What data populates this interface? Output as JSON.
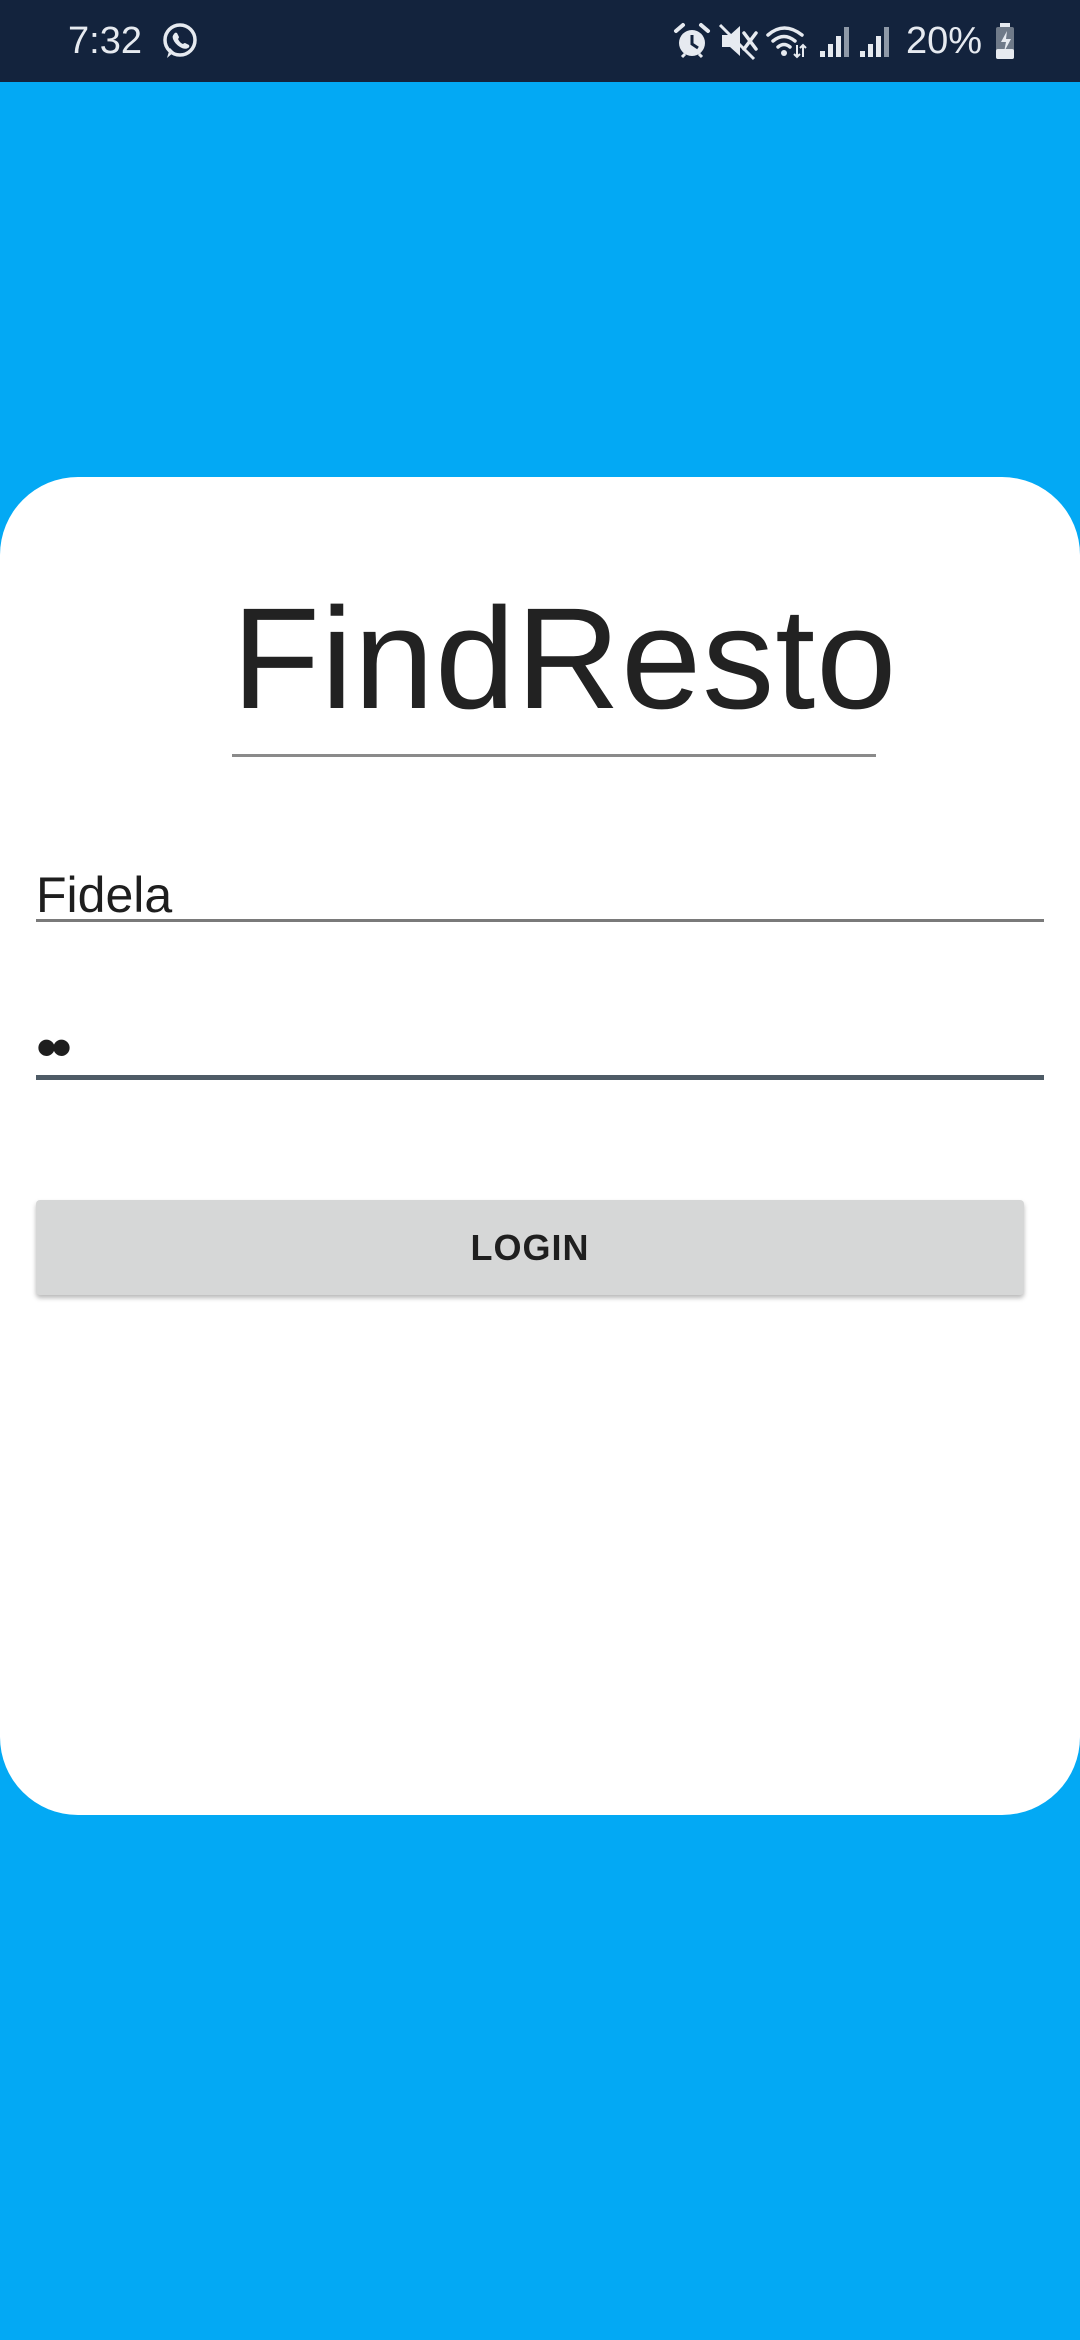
{
  "status_bar": {
    "time": "7:32",
    "battery_percent": "20%",
    "icons": [
      "whatsapp-icon",
      "alarm-icon",
      "mute-icon",
      "wifi-icon",
      "signal-icon",
      "signal-icon",
      "battery-charging-icon"
    ]
  },
  "app": {
    "title": "FindResto"
  },
  "login_form": {
    "username_value": "Fidela",
    "password_masked": "••",
    "login_label": "LOGIN"
  },
  "colors": {
    "background": "#03A9F4",
    "status_bar": "#13233D",
    "card": "#FFFFFF",
    "button": "#D6D7D7"
  }
}
